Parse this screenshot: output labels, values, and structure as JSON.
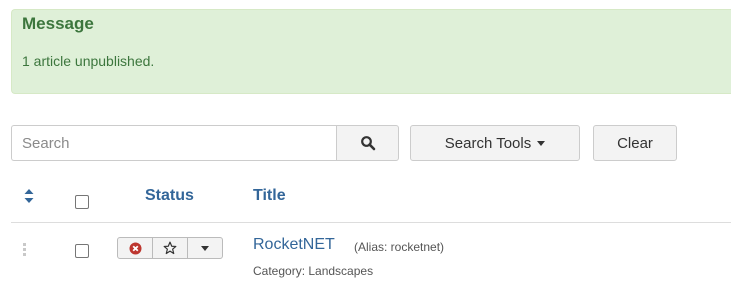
{
  "message": {
    "heading": "Message",
    "text": "1 article unpublished."
  },
  "filters": {
    "search_placeholder": "Search",
    "search_button_icon": "search-icon",
    "search_tools_label": "Search Tools",
    "clear_label": "Clear"
  },
  "table": {
    "columns": {
      "sort_icon": "sort-icon",
      "status": "Status",
      "title": "Title"
    },
    "rows": [
      {
        "title": "RocketNET",
        "alias": "(Alias: rocketnet)",
        "category": "Category: Landscapes",
        "status_icon": "unpublished-icon",
        "featured_icon": "star-outline-icon"
      }
    ]
  },
  "colors": {
    "alert_bg": "#dff0d8",
    "alert_text": "#3c763d",
    "link": "#336699",
    "unpublished": "#bd362f"
  }
}
